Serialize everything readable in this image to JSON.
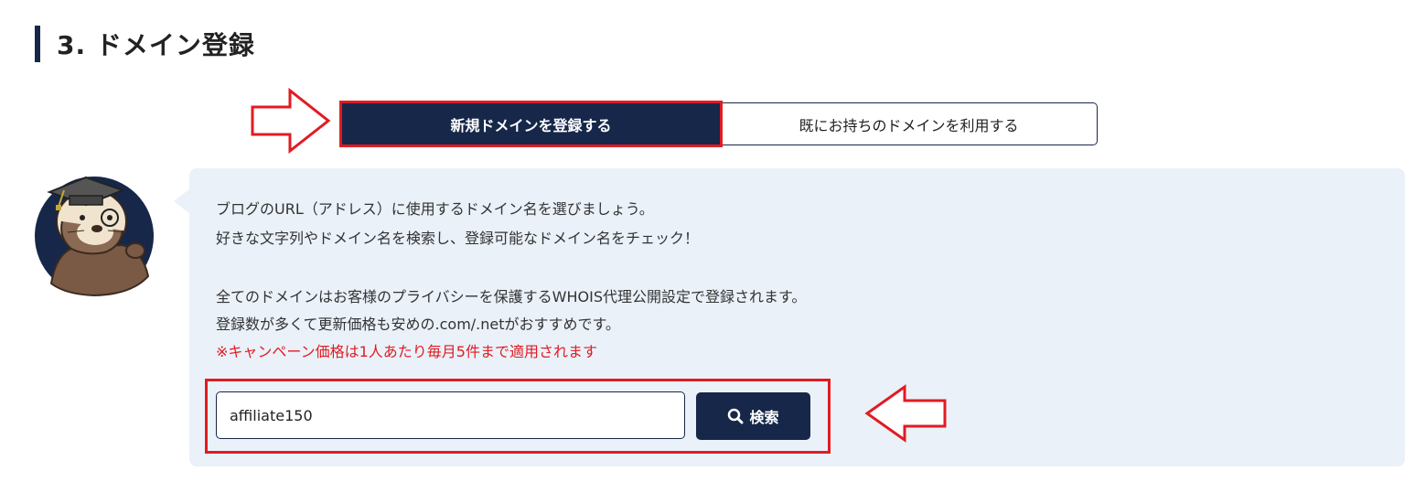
{
  "section": {
    "title": "3. ドメイン登録"
  },
  "tabs": [
    {
      "label": "新規ドメインを登録する",
      "active": true
    },
    {
      "label": "既にお持ちのドメインを利用する",
      "active": false
    }
  ],
  "info": {
    "line1": "ブログのURL（アドレス）に使用するドメイン名を選びましょう。",
    "line2": "好きな文字列やドメイン名を検索し、登録可能なドメイン名をチェック！",
    "line3": "全てのドメインはお客様のプライバシーを保護するWHOIS代理公開設定で登録されます。",
    "line4": "登録数が多くて更新価格も安めの.com/.netがおすすめです。",
    "campaign_note": "※キャンペーン価格は1人あたり毎月5件まで適用されます"
  },
  "search": {
    "value": "affiliate150",
    "button_label": "検索"
  },
  "colors": {
    "navy": "#16274a",
    "highlight_red": "#e11b22",
    "panel_bg": "#eaf1f9"
  },
  "icons": {
    "mascot": "sea-otter-graduate-avatar",
    "search": "search-icon",
    "arrows": "outline-arrow-icon"
  }
}
